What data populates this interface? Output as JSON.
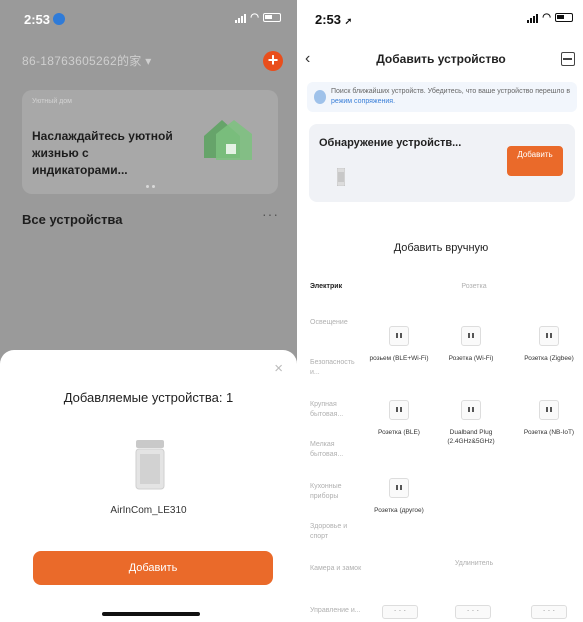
{
  "left": {
    "status": {
      "time": "2:53"
    },
    "home_name": "86-18763605262的家",
    "weather_card": {
      "small_label": "Уютный дом",
      "promo_text": "Наслаждайтесь уютной жизнью с индикаторами..."
    },
    "all_devices": "Все устройства",
    "more": "···",
    "sheet": {
      "close": "×",
      "title": "Добавляемые устройства: 1",
      "device_name": "AirInCom_LE310",
      "add_button": "Добавить"
    }
  },
  "right": {
    "status": {
      "time": "2:53"
    },
    "nav": {
      "back": "‹",
      "title": "Добавить устройство"
    },
    "info": {
      "text": "Поиск ближайших устройств. Убедитесь, что ваше устройство перешло в",
      "link": "режим сопряжения."
    },
    "discover": {
      "title": "Обнаружение устройств...",
      "button": "Добавить"
    },
    "manual_title": "Добавить вручную",
    "categories": [
      "Электрик",
      "Освещение",
      "Безопасность и...",
      "Крупная бытовая...",
      "Мелкая бытовая...",
      "Кухонные приборы",
      "Здоровье и спорт",
      "Камера и замок",
      "Управление и..."
    ],
    "section_socket": "Розетка",
    "tiles": [
      "розьем (BLE+Wi-Fi)",
      "Розетка (Wi-Fi)",
      "Розетка (Zigbee)",
      "Розетка (BLE)",
      "Dualband Plug (2.4GHz&5GHz)",
      "Розетка (NB-IoT)",
      "Розетка (другое)"
    ],
    "section_extender": "Удлинитель"
  },
  "colors": {
    "accent": "#ea6a2a",
    "link": "#3a7fd8"
  }
}
